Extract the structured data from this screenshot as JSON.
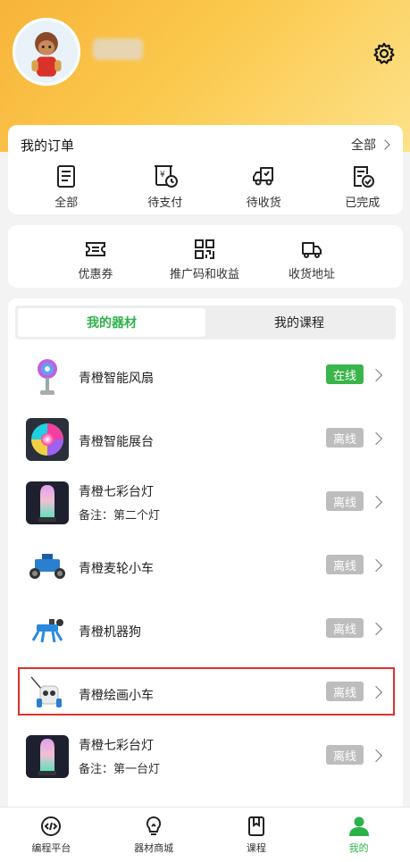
{
  "header": {
    "avatar_icon": "user-avatar-cartoon",
    "settings_icon": "gear-icon"
  },
  "orders": {
    "title": "我的订单",
    "more_label": "全部",
    "items": [
      {
        "label": "全部",
        "icon": "clipboard-list-icon"
      },
      {
        "label": "待支付",
        "icon": "pending-payment-icon"
      },
      {
        "label": "待收货",
        "icon": "delivery-truck-icon"
      },
      {
        "label": "已完成",
        "icon": "completed-check-icon"
      }
    ]
  },
  "services": {
    "items": [
      {
        "label": "优惠券",
        "icon": "coupon-icon"
      },
      {
        "label": "推广码和收益",
        "icon": "qr-code-icon"
      },
      {
        "label": "收货地址",
        "icon": "shipping-truck-icon"
      }
    ]
  },
  "devices": {
    "tabs": [
      {
        "label": "我的器材",
        "active": true
      },
      {
        "label": "我的课程",
        "active": false
      }
    ],
    "list": [
      {
        "name": "青橙智能风扇",
        "note": "",
        "status": "在线",
        "online": true
      },
      {
        "name": "青橙智能展台",
        "note": "",
        "status": "离线",
        "online": false
      },
      {
        "name": "青橙七彩台灯",
        "note": "备注：第二个灯",
        "status": "离线",
        "online": false
      },
      {
        "name": "青橙麦轮小车",
        "note": "",
        "status": "离线",
        "online": false
      },
      {
        "name": "青橙机器狗",
        "note": "",
        "status": "离线",
        "online": false
      },
      {
        "name": "青橙绘画小车",
        "note": "",
        "status": "离线",
        "online": false
      },
      {
        "name": "青橙七彩台灯",
        "note": "备注：第一台灯",
        "status": "离线",
        "online": false
      }
    ]
  },
  "bottom_nav": {
    "items": [
      {
        "label": "编程平台",
        "icon": "code-icon",
        "active": false
      },
      {
        "label": "器材商城",
        "icon": "lightbulb-icon",
        "active": false
      },
      {
        "label": "课程",
        "icon": "bookmark-book-icon",
        "active": false
      },
      {
        "label": "我的",
        "icon": "person-icon",
        "active": true
      }
    ]
  },
  "colors": {
    "accent_green": "#2db24a",
    "online_badge": "#3ab54a",
    "offline_badge": "#bdbdbd",
    "header_gradient_start": "#f7b43a",
    "highlight_red": "#e0302a"
  }
}
